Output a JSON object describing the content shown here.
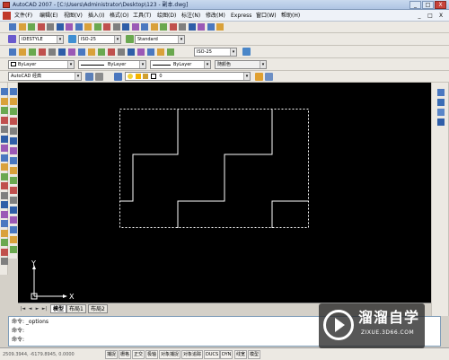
{
  "window": {
    "title": "AutoCAD 2007 - [C:\\Users\\Administrator\\Desktop\\123 - 副本.dwg]",
    "buttons": [
      "_",
      "□",
      "X"
    ]
  },
  "menubar": {
    "items": [
      "文件(F)",
      "编辑(E)",
      "视图(V)",
      "插入(I)",
      "格式(O)",
      "工具(T)",
      "绘图(D)",
      "标注(N)",
      "修改(M)",
      "Express",
      "窗口(W)",
      "帮助(H)"
    ],
    "doc_controls": [
      "_",
      "□",
      "X"
    ]
  },
  "styles_toolbar": {
    "text_style": "IDESTYLE",
    "dim_style": "ISO-25",
    "table_style": "Standard"
  },
  "dimension_toolbar": {
    "dim_style": "ISO-25"
  },
  "properties_toolbar": {
    "color": "ByLayer",
    "linetype": "ByLayer",
    "lineweight": "ByLayer",
    "plotstyle": "随颜色"
  },
  "workspace_toolbar": {
    "workspace": "AutoCAD 经典",
    "layer": "0"
  },
  "ucs": {
    "x_label": "X",
    "y_label": "Y"
  },
  "layout_tabs": {
    "nav": [
      "|◄",
      "◄",
      "►",
      "►|"
    ],
    "tabs": [
      "模型",
      "布局1",
      "布局2"
    ],
    "active": 0
  },
  "command": {
    "lines": [
      "命令: _options",
      "命令:",
      "命令:"
    ]
  },
  "status": {
    "coords": "2509.3944, -6179.8945, 0.0000",
    "buttons": [
      "捕捉",
      "栅格",
      "正交",
      "极轴",
      "对象捕捉",
      "对象追踪",
      "DUCS",
      "DYN",
      "线宽",
      "模型"
    ]
  },
  "watermark": {
    "main": "溜溜自学",
    "sub": "ZIXUE.3D66.COM"
  },
  "colors": {
    "canvas_bg": "#000000",
    "drawing_line": "#ffffff",
    "selection_dash": "#ffffff"
  }
}
